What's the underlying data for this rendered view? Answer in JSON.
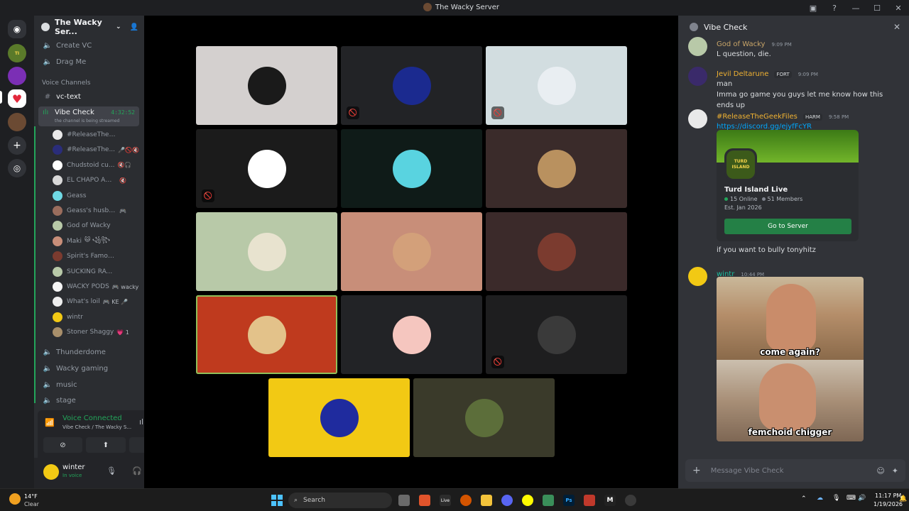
{
  "window": {
    "title": "The Wacky Server"
  },
  "server": {
    "name": "The Wacky Ser..."
  },
  "channels": {
    "top": [
      {
        "label": "Create VC",
        "icon": "speaker-icon"
      },
      {
        "label": "Drag Me",
        "icon": "speaker-icon"
      }
    ],
    "voice_category": "Voice Channels",
    "text_channel": "vc-text",
    "active_voice": {
      "label": "Vibe Check",
      "timer": "4:32:52",
      "sub": "the channel is being streamed"
    },
    "voice_users": [
      {
        "name": "#ReleaseTheGeekFiles",
        "extra": "",
        "color": "#e9e9e9"
      },
      {
        "name": "#ReleaseThe...",
        "extra": "🎤🚫🔇",
        "color": "#2a2d7a"
      },
      {
        "name": "Chudstoid cu...",
        "extra": "🔇🎧",
        "color": "#ffffff"
      },
      {
        "name": "EL CHAPO ANIM...",
        "extra": "🔇",
        "color": "#d9d9d9"
      },
      {
        "name": "Geass",
        "extra": "",
        "color": "#6fd9e4"
      },
      {
        "name": "Geass's husband",
        "extra": "🎮",
        "color": "#9a6d5d"
      },
      {
        "name": "God of Wacky",
        "extra": "",
        "color": "#b8c9a8"
      },
      {
        "name": "Maki",
        "extra": "🐱 ꧁꧂",
        "color": "#c88e79"
      },
      {
        "name": "Spirit's Famous Cousin",
        "extra": "",
        "color": "#7b3b2f"
      },
      {
        "name": "SUCKING RAVEN'S T...",
        "extra": "",
        "color": "#b8c9a8"
      },
      {
        "name": "WACKY PODS",
        "extra": "🎮 wacky",
        "color": "#f5f5f5"
      },
      {
        "name": "What's loil",
        "extra": "🎮 KE 🎤",
        "color": "#eeeeee"
      },
      {
        "name": "wintr",
        "extra": "",
        "color": "#f2c914"
      },
      {
        "name": "Stoner Shaggy",
        "extra": "💗 1",
        "color": "#a88f6b"
      }
    ],
    "bottom": [
      {
        "label": "Thunderdome"
      },
      {
        "label": "Wacky gaming"
      },
      {
        "label": "music"
      },
      {
        "label": "stage"
      }
    ]
  },
  "voice_panel": {
    "status": "Voice Connected",
    "channel": "Vibe Check / The Wacky S..."
  },
  "user_panel": {
    "name": "winter",
    "status": "In voice"
  },
  "tiles": [
    {
      "bg": "#d4d0cf",
      "av": "#1a1a1a",
      "muted": false
    },
    {
      "bg": "#222326",
      "av": "#1b2a8f",
      "muted": true
    },
    {
      "bg": "#d2dde0",
      "av": "#e9eef2",
      "muted": true
    },
    {
      "bg": "#1b1b1b",
      "av": "#ffffff",
      "muted": true
    },
    {
      "bg": "#0f1b18",
      "av": "#59d3e0",
      "muted": false
    },
    {
      "bg": "#3a2b2a",
      "av": "#b9915f",
      "muted": false
    },
    {
      "bg": "#b8c9a8",
      "av": "#e8e3cf",
      "muted": false
    },
    {
      "bg": "#c88e79",
      "av": "#d3a07a",
      "muted": false
    },
    {
      "bg": "#3b2a2a",
      "av": "#7b3b2f",
      "muted": false
    },
    {
      "bg": "#bf3a1e",
      "av": "#e3c28a",
      "muted": false
    },
    {
      "bg": "#222326",
      "av": "#f5c6bf",
      "muted": false
    },
    {
      "bg": "#1e1e1f",
      "av": "#3a3a3a",
      "muted": true
    },
    {
      "bg": "#f2c914",
      "av": "#1f2b9e",
      "muted": false
    },
    {
      "bg": "#3a3a2a",
      "av": "#5c6e3a",
      "muted": false
    }
  ],
  "chat": {
    "channel": "Vibe Check",
    "messages": [
      {
        "user": "God of Wacky",
        "color": "#c7a468",
        "time": "9:09 PM",
        "badge": "",
        "lines": [
          "L question, die."
        ]
      },
      {
        "user": "Jevil Deltarune",
        "color": "#f0b232",
        "time": "9:09 PM",
        "badge": "FORT",
        "lines": [
          "man",
          "Imma go game you guys let me know how this ends up"
        ]
      },
      {
        "user": "#ReleaseTheGeekFiles",
        "color": "#f0b232",
        "time": "9:58 PM",
        "badge": "HARM",
        "lines": [
          "https://discord.gg/ejyfFcYR"
        ]
      },
      {
        "user": "wintr",
        "color": "#1abc9c",
        "time": "10:44 PM",
        "badge": "",
        "lines": []
      }
    ],
    "invite": {
      "name": "Turd Island Live",
      "online": "15 Online",
      "members": "51 Members",
      "est": "Est. Jan 2026",
      "button": "Go to Server",
      "logo_text": "TURD ISLAND"
    },
    "after_invite": "if you want to bully tonyhitz",
    "meme": {
      "top": "come again?",
      "bottom": "femchoid chigger"
    },
    "input_placeholder": "Message Vibe Check"
  },
  "taskbar": {
    "weather_temp": "14°F",
    "weather_desc": "Clear",
    "search": "Search",
    "time": "11:17 PM",
    "date": "1/19/2026"
  }
}
